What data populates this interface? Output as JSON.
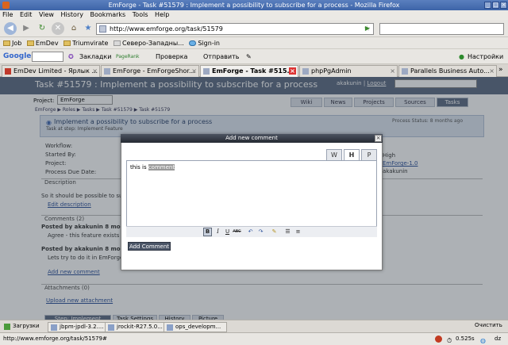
{
  "window": {
    "title": "EmForge - Task #51579 : Implement a possibility to subscribe for a process - Mozilla Firefox"
  },
  "menu": [
    "File",
    "Edit",
    "View",
    "History",
    "Bookmarks",
    "Tools",
    "Help"
  ],
  "nav": {
    "url": "http://www.emforge.org/task/51579"
  },
  "bookmarks": [
    {
      "label": "Job"
    },
    {
      "label": "EmDev"
    },
    {
      "label": "Triumvirate"
    },
    {
      "label": "Северо-Западны..."
    },
    {
      "label": "Sign-in"
    }
  ],
  "google_toolbar": {
    "logo": "Google",
    "bookmarks_label": "Закладки",
    "pagerank_label": "PageRank",
    "check_label": "Проверка",
    "send_label": "Отправить",
    "settings_label": "Настройки"
  },
  "tabs": [
    {
      "label": "EmDev Limited - Ярлык ..."
    },
    {
      "label": "EmForge - EmForgeShor..."
    },
    {
      "label": "EmForge - Task #515...",
      "active": true
    },
    {
      "label": "phpPgAdmin"
    },
    {
      "label": "Parallels Business Auto..."
    }
  ],
  "page": {
    "header_title": "Task #51579 : Implement a possibility to subscribe for a process",
    "user": "akakunin",
    "logout": "Logout",
    "project_label": "Project:",
    "project_value": "EmForge",
    "nav_tabs": [
      "Wiki",
      "News",
      "Projects",
      "Sources",
      "Tasks"
    ],
    "breadcrumb": "EmForge ▶ Roles ▶ Tasks ▶ Task #51579 ▶ Task #51579",
    "task_title": "Implement a possibility to subscribe for a process",
    "task_sub": "Task at step: Implement Feature",
    "task_status": "Process Status: 8 months ago",
    "fields": [
      {
        "label": "Workflow:",
        "value": ""
      },
      {
        "label": "Started By:",
        "value": "High"
      },
      {
        "label": "Project:",
        "value": "EmForge-1.0"
      },
      {
        "label": "Process Due Date:",
        "value": "akakunin"
      }
    ],
    "description_header": "Description",
    "description_text": "So it should be possible to subscr...",
    "edit_description": "Edit description",
    "comments_header": "Comments (2)",
    "comments": [
      {
        "author": "Posted by akakunin 8 month",
        "text": "Agree - this feature exists in..."
      },
      {
        "author": "Posted by akakunin 8 month",
        "text": "Lets try to do it in EmForge-..."
      }
    ],
    "add_new_comment": "Add new comment",
    "attachments_header": "Attachments (0)",
    "upload_attachment": "Upload new attachment",
    "footer_tabs": [
      "Step: Implement Feature",
      "Task Settings",
      "History",
      "Picture"
    ]
  },
  "modal": {
    "title": "Add new comment",
    "editor_text_plain": "this is ",
    "editor_text_selected": "comment",
    "mode_tabs": [
      "W",
      "H",
      "P"
    ],
    "submit_label": "Add Comment"
  },
  "taskbar": [
    {
      "label": "Загрузки"
    },
    {
      "label": "jbpm-jpdl-3.2...."
    },
    {
      "label": "jrockit-R27.5.0..."
    },
    {
      "label": "ops_developm..."
    }
  ],
  "taskbar_clear": "Очистить",
  "status": {
    "url": "http://www.emforge.org/task/51579#",
    "timer": "0.525s",
    "dz": "dz"
  }
}
